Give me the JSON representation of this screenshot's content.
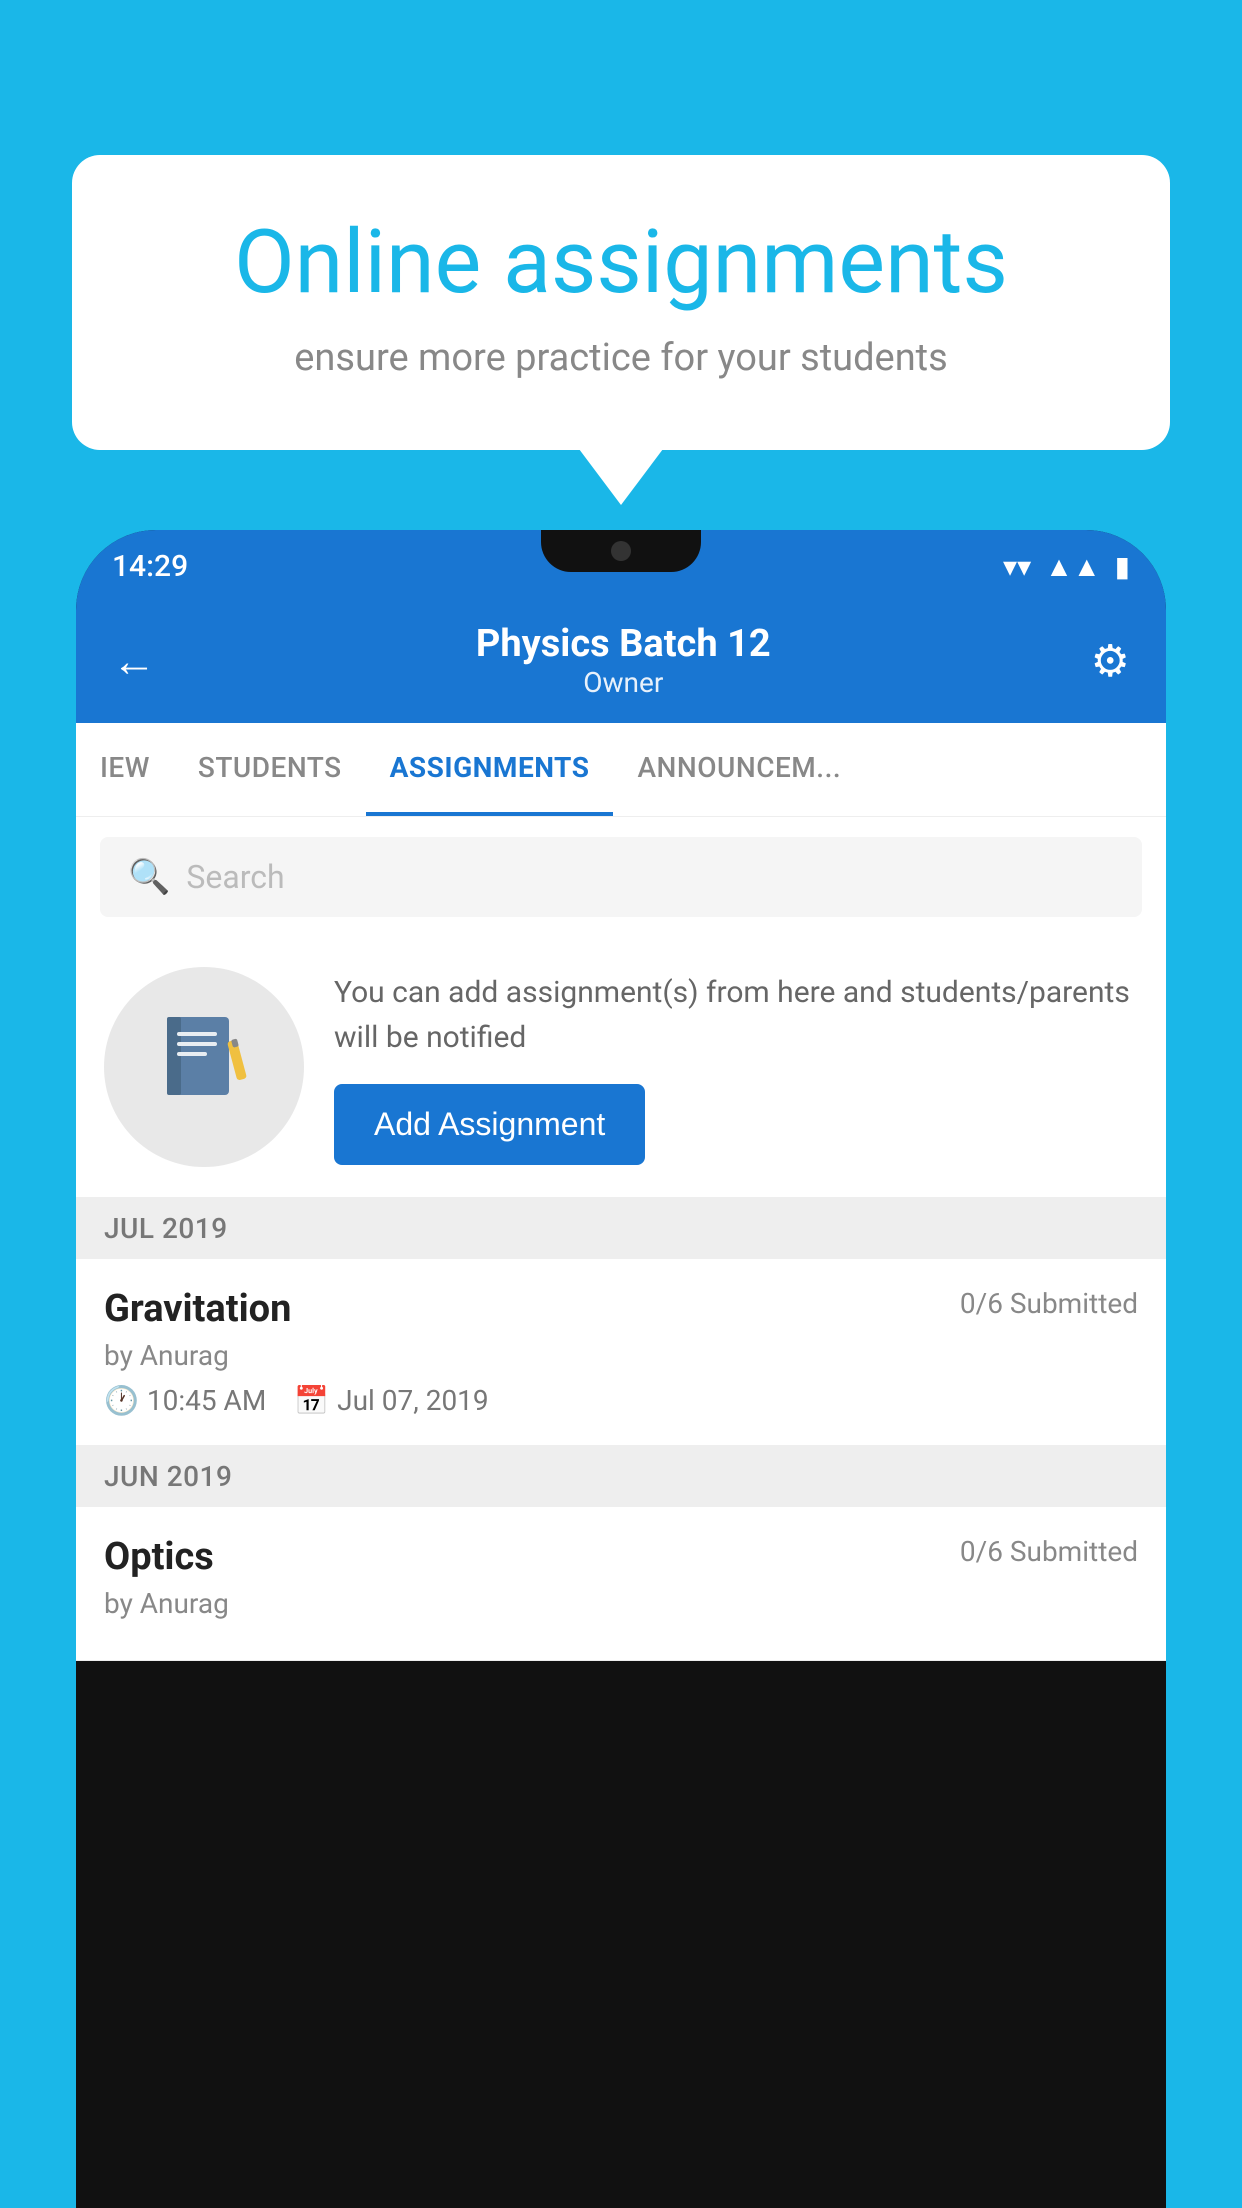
{
  "background": {
    "color": "#1ab7e8"
  },
  "speech_bubble": {
    "title": "Online assignments",
    "subtitle": "ensure more practice for your students"
  },
  "phone": {
    "status_bar": {
      "time": "14:29",
      "wifi_icon": "▼",
      "signal_icon": "▲",
      "battery_icon": "▮"
    },
    "header": {
      "back_icon": "←",
      "title": "Physics Batch 12",
      "subtitle": "Owner",
      "settings_icon": "⚙"
    },
    "tabs": [
      {
        "label": "IEW",
        "active": false
      },
      {
        "label": "STUDENTS",
        "active": false
      },
      {
        "label": "ASSIGNMENTS",
        "active": true
      },
      {
        "label": "ANNOUNCEM...",
        "active": false
      }
    ],
    "search": {
      "placeholder": "Search"
    },
    "promo": {
      "icon": "📓",
      "text": "You can add assignment(s) from here and students/parents will be notified",
      "button_label": "Add Assignment"
    },
    "sections": [
      {
        "label": "JUL 2019",
        "assignments": [
          {
            "name": "Gravitation",
            "submitted": "0/6 Submitted",
            "by": "by Anurag",
            "time": "10:45 AM",
            "date": "Jul 07, 2019"
          }
        ]
      },
      {
        "label": "JUN 2019",
        "assignments": [
          {
            "name": "Optics",
            "submitted": "0/6 Submitted",
            "by": "by Anurag",
            "time": "",
            "date": ""
          }
        ]
      }
    ]
  }
}
